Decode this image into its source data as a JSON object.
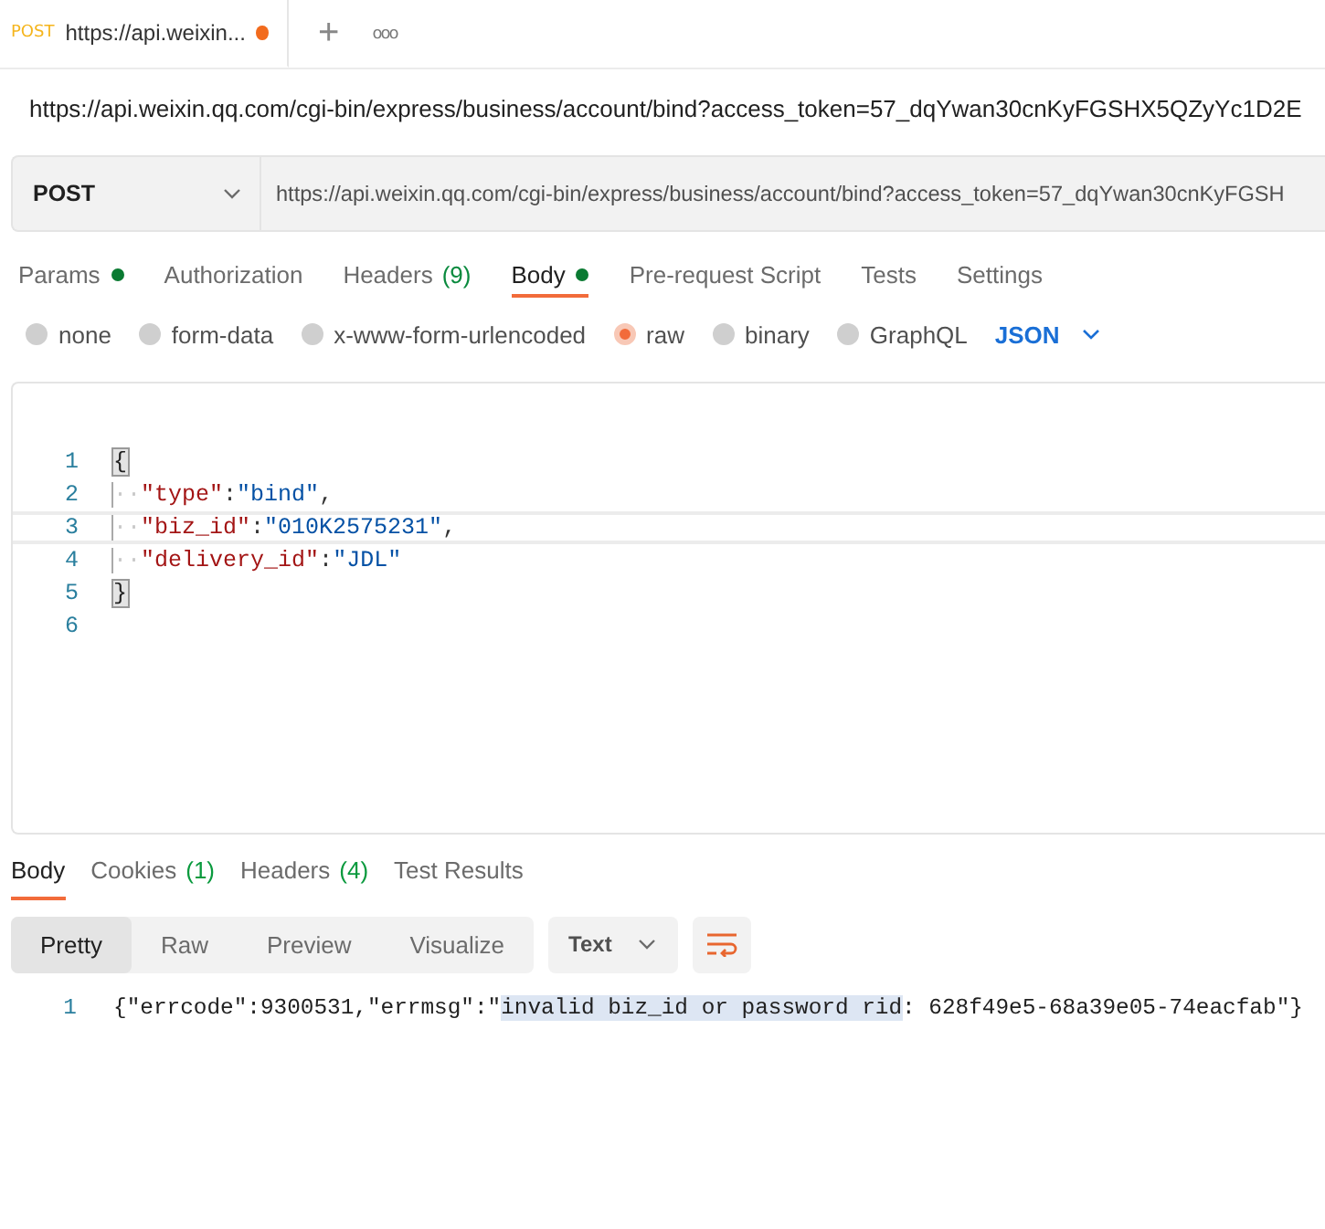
{
  "request_tab": {
    "method": "POST",
    "title": "https://api.weixin...",
    "unsaved": true
  },
  "new_tab_icon": "+",
  "more_icon": "ooo",
  "request_title": "https://api.weixin.qq.com/cgi-bin/express/business/account/bind?access_token=57_dqYwan30cnKyFGSHX5QZyYc1D2E",
  "url_bar": {
    "method": "POST",
    "url": "https://api.weixin.qq.com/cgi-bin/express/business/account/bind?access_token=57_dqYwan30cnKyFGSH"
  },
  "request_tabs": [
    {
      "label": "Params",
      "dot": true,
      "selected": false
    },
    {
      "label": "Authorization",
      "dot": false,
      "selected": false
    },
    {
      "label": "Headers",
      "count": "(9)",
      "dot": false,
      "selected": false
    },
    {
      "label": "Body",
      "dot": true,
      "selected": true
    },
    {
      "label": "Pre-request Script",
      "dot": false,
      "selected": false
    },
    {
      "label": "Tests",
      "dot": false,
      "selected": false
    },
    {
      "label": "Settings",
      "dot": false,
      "selected": false
    }
  ],
  "body_types": [
    {
      "label": "none",
      "selected": false
    },
    {
      "label": "form-data",
      "selected": false
    },
    {
      "label": "x-www-form-urlencoded",
      "selected": false
    },
    {
      "label": "raw",
      "selected": true
    },
    {
      "label": "binary",
      "selected": false
    },
    {
      "label": "GraphQL",
      "selected": false
    }
  ],
  "format": "JSON",
  "editor_lines": [
    {
      "number": "1",
      "current": false,
      "tokens": [
        {
          "kind": "bracket",
          "text": "{"
        }
      ]
    },
    {
      "number": "2",
      "current": false,
      "tokens": [
        {
          "kind": "ws",
          "text": "··"
        },
        {
          "kind": "key",
          "text": "\"type\""
        },
        {
          "kind": "punct",
          "text": ":"
        },
        {
          "kind": "string",
          "text": "\"bind\""
        },
        {
          "kind": "punct",
          "text": ","
        }
      ]
    },
    {
      "number": "3",
      "current": true,
      "tokens": [
        {
          "kind": "ws",
          "text": "··"
        },
        {
          "kind": "key",
          "text": "\"biz_id\""
        },
        {
          "kind": "punct",
          "text": ":"
        },
        {
          "kind": "string",
          "text": "\"010K2575231\""
        },
        {
          "kind": "punct",
          "text": ","
        }
      ]
    },
    {
      "number": "4",
      "current": false,
      "tokens": [
        {
          "kind": "ws",
          "text": "··"
        },
        {
          "kind": "key",
          "text": "\"delivery_id\""
        },
        {
          "kind": "punct",
          "text": ":"
        },
        {
          "kind": "string",
          "text": "\"JDL\""
        }
      ]
    },
    {
      "number": "5",
      "current": false,
      "tokens": [
        {
          "kind": "bracket",
          "text": "}"
        }
      ]
    },
    {
      "number": "6",
      "current": false
    }
  ],
  "response_tabs": [
    {
      "label": "Body",
      "selected": true
    },
    {
      "label": "Cookies",
      "count": "(1)",
      "selected": false
    },
    {
      "label": "Headers",
      "count": "(4)",
      "selected": false
    },
    {
      "label": "Test Results",
      "selected": false
    }
  ],
  "view_modes": [
    {
      "label": "Pretty",
      "selected": true
    },
    {
      "label": "Raw",
      "selected": false
    },
    {
      "label": "Preview",
      "selected": false
    },
    {
      "label": "Visualize",
      "selected": false
    }
  ],
  "response_format": "Text",
  "response_lines": [
    {
      "number": "1",
      "parts": [
        {
          "text": "{\"errcode\":9300531,\"errmsg\":\"",
          "selected": false
        },
        {
          "text": "invalid biz_id or password rid",
          "selected": true
        },
        {
          "text": ": 628f49e5-68a39e05-74eacfab\"}",
          "selected": false
        }
      ]
    }
  ]
}
